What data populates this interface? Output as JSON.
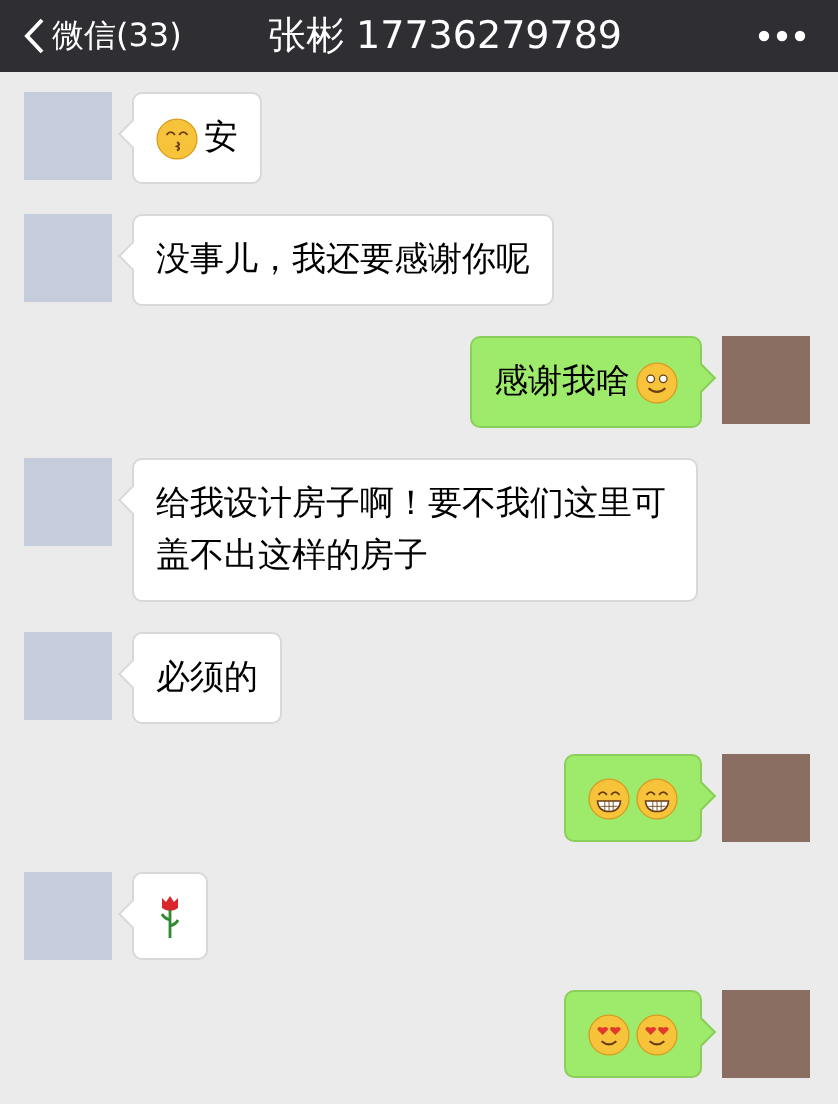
{
  "header": {
    "back_label": "微信(33)",
    "title": "张彬 17736279789"
  },
  "messages": [
    {
      "kind": "incoming",
      "parts": [
        {
          "kind": "kiss"
        },
        {
          "kind": "text",
          "text": "安"
        }
      ]
    },
    {
      "kind": "incoming",
      "parts": [
        {
          "kind": "text",
          "text": "没事儿，我还要感谢你呢"
        }
      ]
    },
    {
      "kind": "outgoing",
      "parts": [
        {
          "kind": "text",
          "text": "感谢我啥"
        },
        {
          "kind": "smile"
        }
      ]
    },
    {
      "kind": "incoming",
      "parts": [
        {
          "kind": "text",
          "text": "给我设计房子啊！要不我们这里可盖不出这样的房子"
        }
      ]
    },
    {
      "kind": "incoming",
      "parts": [
        {
          "kind": "text",
          "text": "必须的"
        }
      ]
    },
    {
      "kind": "outgoing",
      "parts": [
        {
          "kind": "grin"
        },
        {
          "kind": "grin"
        }
      ]
    },
    {
      "kind": "incoming",
      "parts": [
        {
          "kind": "rose"
        }
      ]
    },
    {
      "kind": "outgoing",
      "parts": [
        {
          "kind": "hearteyes"
        },
        {
          "kind": "hearteyes"
        }
      ]
    }
  ]
}
